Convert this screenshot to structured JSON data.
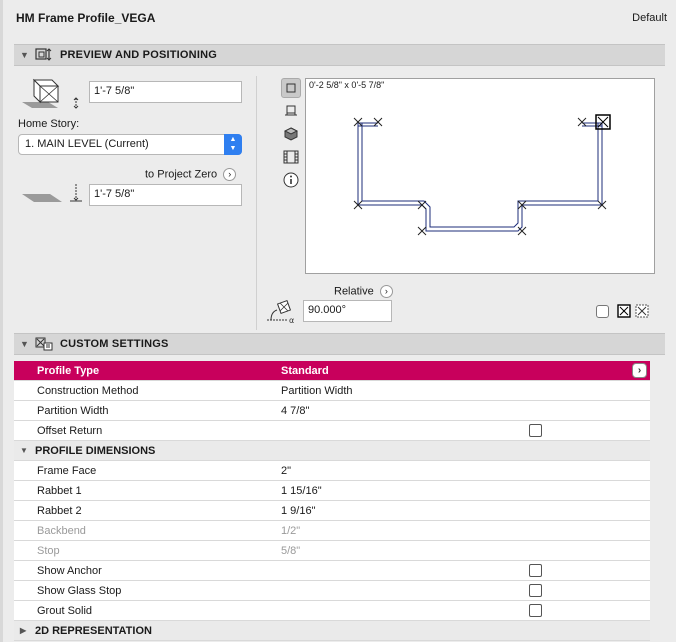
{
  "window": {
    "title": "HM Frame Profile_VEGA",
    "mode": "Default"
  },
  "preview_section": {
    "title": "PREVIEW AND POSITIONING",
    "top_elevation": "1'-7 5/8\"",
    "home_story_label": "Home Story:",
    "home_story_value": "1. MAIN LEVEL (Current)",
    "to_project_zero_label": "to Project Zero",
    "bottom_elevation": "1'-7 5/8\"",
    "preview_dimension": "0'-2 5/8\" x 0'-5 7/8\"",
    "relative_label": "Relative",
    "angle_value": "90.000°"
  },
  "custom_section": {
    "title": "CUSTOM SETTINGS",
    "rows": [
      {
        "label": "Profile Type",
        "value": "Standard",
        "kind": "highlight"
      },
      {
        "label": "Construction Method",
        "value": "Partition Width",
        "kind": "normal"
      },
      {
        "label": "Partition Width",
        "value": "4 7/8\"",
        "kind": "normal"
      },
      {
        "label": "Offset Return",
        "value": "",
        "kind": "checkbox"
      },
      {
        "label": "PROFILE DIMENSIONS",
        "value": "",
        "kind": "group"
      },
      {
        "label": "Frame Face",
        "value": "2\"",
        "kind": "normal"
      },
      {
        "label": "Rabbet 1",
        "value": "1 15/16\"",
        "kind": "normal"
      },
      {
        "label": "Rabbet 2",
        "value": "1 9/16\"",
        "kind": "normal"
      },
      {
        "label": "Backbend",
        "value": "1/2\"",
        "kind": "dim"
      },
      {
        "label": "Stop",
        "value": "5/8\"",
        "kind": "dim"
      },
      {
        "label": "Show Anchor",
        "value": "",
        "kind": "checkbox"
      },
      {
        "label": "Show Glass Stop",
        "value": "",
        "kind": "checkbox"
      },
      {
        "label": "Grout Solid",
        "value": "",
        "kind": "checkbox"
      },
      {
        "label": "2D REPRESENTATION",
        "value": "",
        "kind": "group-collapsed"
      }
    ]
  },
  "icons": {
    "preview_tools": [
      "plan-view-icon",
      "section-view-icon",
      "3d-view-icon",
      "filmstrip-icon",
      "info-icon"
    ]
  },
  "colors": {
    "highlight": "#c8005c",
    "dropdown_accent": "#2f7ff0"
  }
}
